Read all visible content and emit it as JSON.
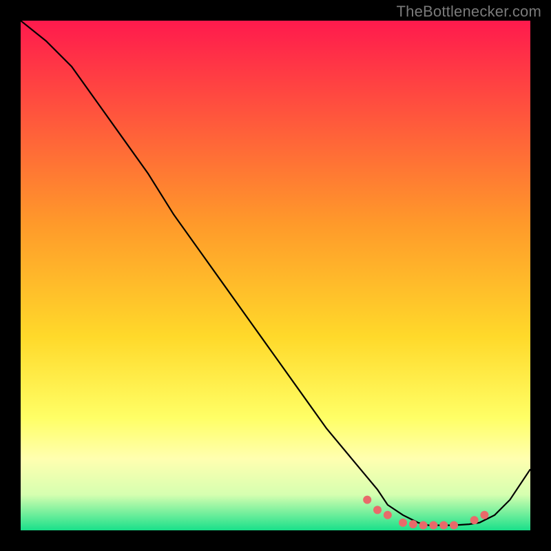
{
  "watermark": "TheBottlenecker.com",
  "chart_data": {
    "type": "line",
    "title": "",
    "xlabel": "",
    "ylabel": "",
    "xlim": [
      0,
      100
    ],
    "ylim": [
      0,
      100
    ],
    "grid": false,
    "legend": false,
    "background_gradient_stops": [
      {
        "pos": 0.0,
        "color": "#ff1a4d"
      },
      {
        "pos": 0.4,
        "color": "#ff9a2a"
      },
      {
        "pos": 0.62,
        "color": "#ffd92a"
      },
      {
        "pos": 0.78,
        "color": "#ffff66"
      },
      {
        "pos": 0.86,
        "color": "#ffffb0"
      },
      {
        "pos": 0.93,
        "color": "#d6ffb0"
      },
      {
        "pos": 1.0,
        "color": "#19e08a"
      }
    ],
    "series": [
      {
        "name": "curve",
        "color": "#000000",
        "x": [
          0,
          5,
          10,
          15,
          20,
          25,
          30,
          35,
          40,
          45,
          50,
          55,
          60,
          65,
          70,
          72,
          75,
          78,
          80,
          83,
          85,
          88,
          90,
          93,
          96,
          100
        ],
        "y": [
          100,
          96,
          91,
          84,
          77,
          70,
          62,
          55,
          48,
          41,
          34,
          27,
          20,
          14,
          8,
          5,
          3,
          1.5,
          1,
          1,
          1,
          1.2,
          1.5,
          3,
          6,
          12
        ]
      }
    ],
    "markers": {
      "name": "dots",
      "color": "#e86a6a",
      "x": [
        68,
        70,
        72,
        75,
        77,
        79,
        81,
        83,
        85,
        89,
        91
      ],
      "y": [
        6,
        4,
        3,
        1.5,
        1.2,
        1,
        1,
        1,
        1,
        2,
        3
      ]
    }
  }
}
